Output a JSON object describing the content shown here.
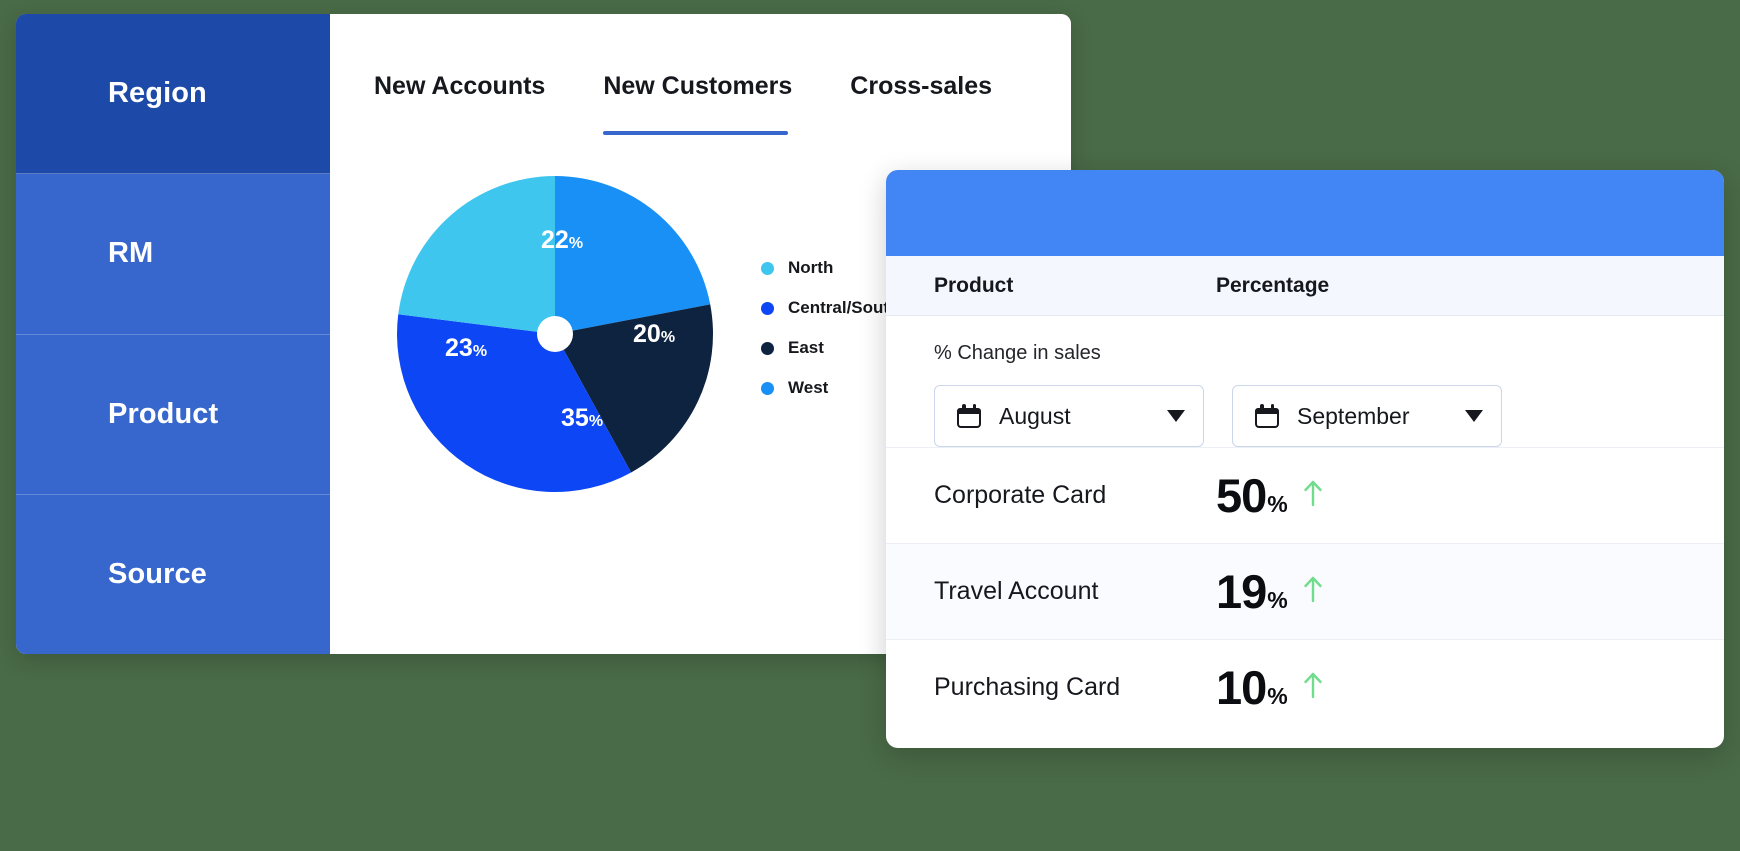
{
  "sidebar": {
    "items": [
      {
        "label": "Region",
        "active": true
      },
      {
        "label": "RM",
        "active": false
      },
      {
        "label": "Product",
        "active": false
      },
      {
        "label": "Source",
        "active": false
      }
    ]
  },
  "tabs": [
    {
      "label": "New Accounts",
      "active": false
    },
    {
      "label": "New Customers",
      "active": true
    },
    {
      "label": "Cross-sales",
      "active": false
    }
  ],
  "colors": {
    "background": "#4a6b47",
    "sidebar": "#3767cd",
    "sidebar_active": "#1d4aa8",
    "accent": "#3767cd",
    "panel_banner": "#4285f4",
    "north": "#3ec6ef",
    "central_south": "#0d47f5",
    "east": "#0d2340",
    "west": "#1890f5",
    "up_arrow": "#6fdd8b"
  },
  "chart_data": {
    "type": "pie",
    "title": "New Customers",
    "categories": [
      "West",
      "East",
      "Central/South",
      "North"
    ],
    "values": [
      22,
      20,
      35,
      23
    ],
    "labels": [
      "22",
      "20",
      "35",
      "23"
    ],
    "unit": "%",
    "colors": [
      "#1890f5",
      "#0d2340",
      "#0d47f5",
      "#3ec6ef"
    ],
    "start_angle": 0,
    "donut_hole": true,
    "legend": [
      {
        "label": "North",
        "color": "#3ec6ef"
      },
      {
        "label": "Central/South",
        "color": "#0d47f5"
      },
      {
        "label": "East",
        "color": "#0d2340"
      },
      {
        "label": "West",
        "color": "#1890f5"
      }
    ],
    "legend_position": "right",
    "grid": false
  },
  "panel": {
    "headers": {
      "product": "Product",
      "percentage": "Percentage"
    },
    "change_title": "% Change in sales",
    "selects": [
      {
        "name": "month-from",
        "value": "August",
        "icon": "calendar-icon"
      },
      {
        "name": "month-to",
        "value": "September",
        "icon": "calendar-icon"
      }
    ],
    "rows": [
      {
        "product": "Corporate Card",
        "value": "50",
        "unit": "%",
        "trend": "up"
      },
      {
        "product": "Travel Account",
        "value": "19",
        "unit": "%",
        "trend": "up"
      },
      {
        "product": "Purchasing Card",
        "value": "10",
        "unit": "%",
        "trend": "up"
      }
    ]
  }
}
